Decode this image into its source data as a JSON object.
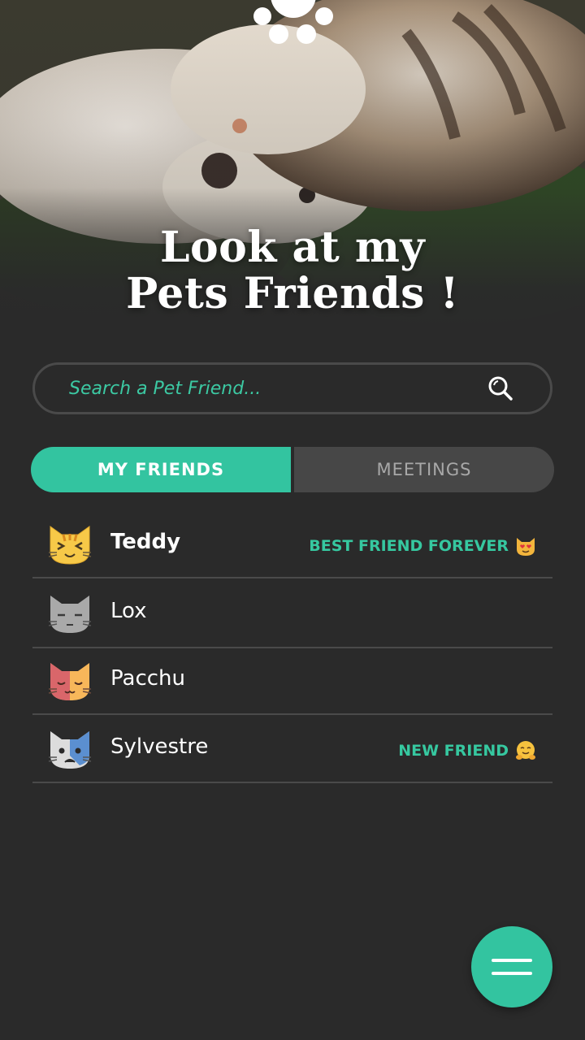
{
  "hero": {
    "title_line1": "Look at my",
    "title_line2": "Pets Friends !",
    "image": "cat-and-dog-cuddling-photo",
    "logo_icon": "paw-icon"
  },
  "search": {
    "placeholder": "Search a Pet Friend...",
    "value": "",
    "icon": "search-icon"
  },
  "tabs": [
    {
      "label": "MY FRIENDS",
      "active": true
    },
    {
      "label": "MEETINGS",
      "active": false
    }
  ],
  "friends": [
    {
      "name": "Teddy",
      "avatar": "cat-laughing-yellow-icon",
      "tag": "BEST FRIEND FOREVER",
      "tag_icon": "heart-eyes-cat-emoji"
    },
    {
      "name": "Lox",
      "avatar": "cat-sleepy-grey-icon",
      "tag": "",
      "tag_icon": ""
    },
    {
      "name": "Pacchu",
      "avatar": "cat-calico-sleepy-icon",
      "tag": "",
      "tag_icon": ""
    },
    {
      "name": "Sylvestre",
      "avatar": "cat-sad-white-blue-icon",
      "tag": "NEW FRIEND",
      "tag_icon": "hugging-face-emoji"
    }
  ],
  "fab": {
    "icon": "menu-icon"
  },
  "colors": {
    "background": "#2a2a2a",
    "accent": "#33c4a0",
    "tab_inactive": "#474747",
    "divider": "#4a4a4a"
  }
}
